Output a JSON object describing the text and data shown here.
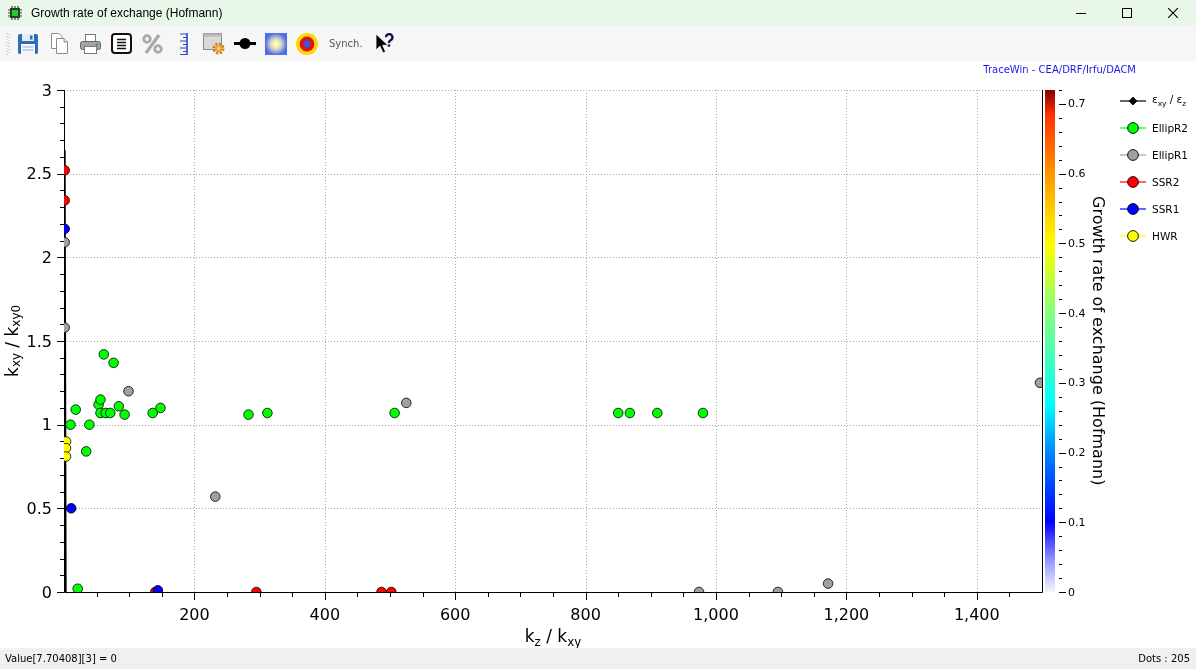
{
  "window": {
    "title": "Growth rate of exchange (Hofmann)"
  },
  "toolbar": {
    "items": [
      {
        "kind": "save"
      },
      {
        "kind": "copy"
      },
      {
        "kind": "print"
      },
      {
        "kind": "text"
      },
      {
        "kind": "percent"
      },
      {
        "kind": "ruler"
      },
      {
        "kind": "settings"
      },
      {
        "kind": "line-marker"
      },
      {
        "kind": "gradient"
      },
      {
        "kind": "target"
      },
      {
        "kind": "label",
        "label": "Synch."
      },
      {
        "kind": "help"
      }
    ]
  },
  "chart": {
    "credit": "TraceWin - CEA/DRF/Irfu/DACM",
    "color_scale": {
      "title": "Growth rate of exchange (Hofmann)",
      "tick_labels": [
        "0.7",
        "0.6",
        "0.5",
        "0.4",
        "0.3",
        "0.2",
        "0.1",
        "0"
      ]
    },
    "chart_data": {
      "type": "scatter",
      "xlabel": "k$_{z}$ / k$_{xy}$",
      "ylabel": "k$_{xy}$ / k$_{xy0}$",
      "xlim": [
        0,
        1500
      ],
      "ylim": [
        0,
        3
      ],
      "xticks": [
        {
          "value": 200,
          "label": "200"
        },
        {
          "value": 400,
          "label": "400"
        },
        {
          "value": 600,
          "label": "600"
        },
        {
          "value": 800,
          "label": "800"
        },
        {
          "value": 1000,
          "label": "1,000"
        },
        {
          "value": 1200,
          "label": "1,200"
        },
        {
          "value": 1400,
          "label": "1,400"
        }
      ],
      "yticks": [
        {
          "value": 0,
          "label": "0"
        },
        {
          "value": 0.5,
          "label": "0.5"
        },
        {
          "value": 1,
          "label": "1"
        },
        {
          "value": 1.5,
          "label": "1.5"
        },
        {
          "value": 2,
          "label": "2"
        },
        {
          "value": 2.5,
          "label": "2.5"
        },
        {
          "value": 3,
          "label": "3"
        }
      ],
      "grid": true,
      "legend": true,
      "series": [
        {
          "name": "ε$_{xy}$ / ε$_{z}$",
          "type": "line",
          "color": "#000000",
          "x": [
            1,
            2.5
          ],
          "values": [
            2.64,
            0
          ]
        },
        {
          "name": "EllipR2",
          "type": "scatter",
          "color": "#00ff00",
          "x": [
            21,
            10,
            18,
            34,
            39,
            53,
            56,
            61,
            56,
            64,
            71,
            76,
            84,
            93,
            136,
            148,
            283,
            312,
            507,
            850,
            868,
            910,
            980
          ],
          "values": [
            0.02,
            1.0,
            1.09,
            0.84,
            1.0,
            1.12,
            1.15,
            1.42,
            1.07,
            1.07,
            1.07,
            1.37,
            1.11,
            1.06,
            1.07,
            1.1,
            1.06,
            1.07,
            1.07,
            1.07,
            1.07,
            1.07,
            1.07
          ]
        },
        {
          "name": "EllipR1",
          "type": "scatter",
          "color": "#a0a0a0",
          "x": [
            1,
            1,
            99,
            232,
            525,
            974,
            1095,
            1172,
            1497
          ],
          "values": [
            2.09,
            1.58,
            1.2,
            0.57,
            1.13,
            0,
            0,
            0.05,
            1.25
          ]
        },
        {
          "name": "SSR2",
          "type": "scatter",
          "color": "#ff0000",
          "x": [
            1,
            1,
            140,
            295,
            487,
            502
          ],
          "values": [
            2.52,
            2.34,
            0,
            0,
            0,
            0
          ]
        },
        {
          "name": "SSR1",
          "type": "scatter",
          "color": "#0000ff",
          "x": [
            1,
            11,
            144
          ],
          "values": [
            2.17,
            0.5,
            0.01
          ]
        },
        {
          "name": "HWR",
          "type": "scatter",
          "color": "#ffff00",
          "x": [
            3,
            3,
            3
          ],
          "values": [
            0.9,
            0.86,
            0.81
          ]
        }
      ]
    }
  },
  "status_bar": {
    "value_readout": "Value[7.70408][3] = 0",
    "dots": "Dots : 205"
  }
}
